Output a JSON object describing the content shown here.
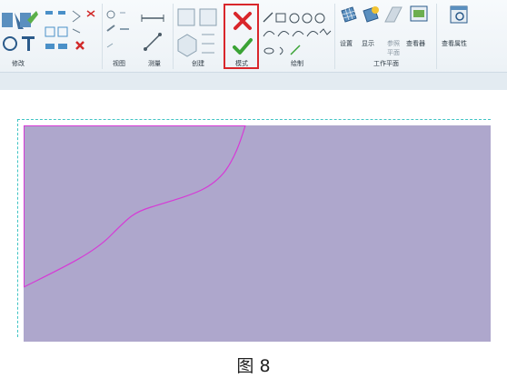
{
  "ribbon": {
    "panels": {
      "modify": "修改",
      "view": "视图",
      "measure": "测量",
      "create": "创建",
      "mode": "模式",
      "draw": "绘制",
      "workplane": "工作平面"
    },
    "workplane_buttons": {
      "set": "设置",
      "show": "显示",
      "ref_plane_line1": "参照",
      "ref_plane_line2": "平面",
      "viewer": "查看器"
    },
    "properties_button": "查看属性"
  },
  "canvas": {
    "fill_color": "#aea7cc",
    "curve_color": "#d63ad6",
    "frame_color": "#40c4c4"
  },
  "caption": "图 8"
}
